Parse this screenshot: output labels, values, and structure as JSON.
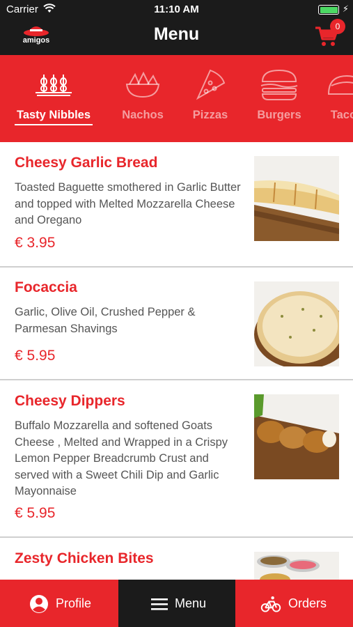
{
  "status_bar": {
    "carrier": "Carrier",
    "time": "11:10 AM"
  },
  "header": {
    "logo_text": "amigos",
    "title": "Menu",
    "cart_count": "0"
  },
  "categories": [
    {
      "label": "Tasty Nibbles",
      "icon": "skewers-icon",
      "active": true
    },
    {
      "label": "Nachos",
      "icon": "nachos-bowl-icon",
      "active": false
    },
    {
      "label": "Pizzas",
      "icon": "pizza-slice-icon",
      "active": false
    },
    {
      "label": "Burgers",
      "icon": "burger-icon",
      "active": false
    },
    {
      "label": "Tacos",
      "icon": "taco-icon",
      "active": false
    }
  ],
  "menu_items": [
    {
      "name": "Cheesy Garlic Bread",
      "description": "Toasted Baguette smothered in Garlic Butter and topped with Melted Mozzarella Cheese and Oregano",
      "price": "€ 3.95",
      "image": "garlic-bread-photo"
    },
    {
      "name": "Focaccia",
      "description": "Garlic, Olive Oil, Crushed Pepper & Parmesan Shavings",
      "price": "€ 5.95",
      "image": "focaccia-photo"
    },
    {
      "name": "Cheesy Dippers",
      "description": "Buffalo Mozzarella and softened Goats Cheese , Melted and Wrapped in a Crispy Lemon Pepper Breadcrumb Crust and served with a Sweet Chili Dip and Garlic Mayonnaise",
      "price": "€ 5.95",
      "image": "cheesy-dippers-photo"
    },
    {
      "name": "Zesty Chicken Bites",
      "description": "",
      "price": "",
      "image": "chicken-bites-photo"
    }
  ],
  "tabs": [
    {
      "label": "Profile",
      "icon": "person-icon"
    },
    {
      "label": "Menu",
      "icon": "hamburger-menu-icon"
    },
    {
      "label": "Orders",
      "icon": "bicycle-icon"
    }
  ],
  "colors": {
    "brand_red": "#e8262b",
    "header_dark": "#1b1b1b",
    "tab_active": "#1b1b1b"
  }
}
